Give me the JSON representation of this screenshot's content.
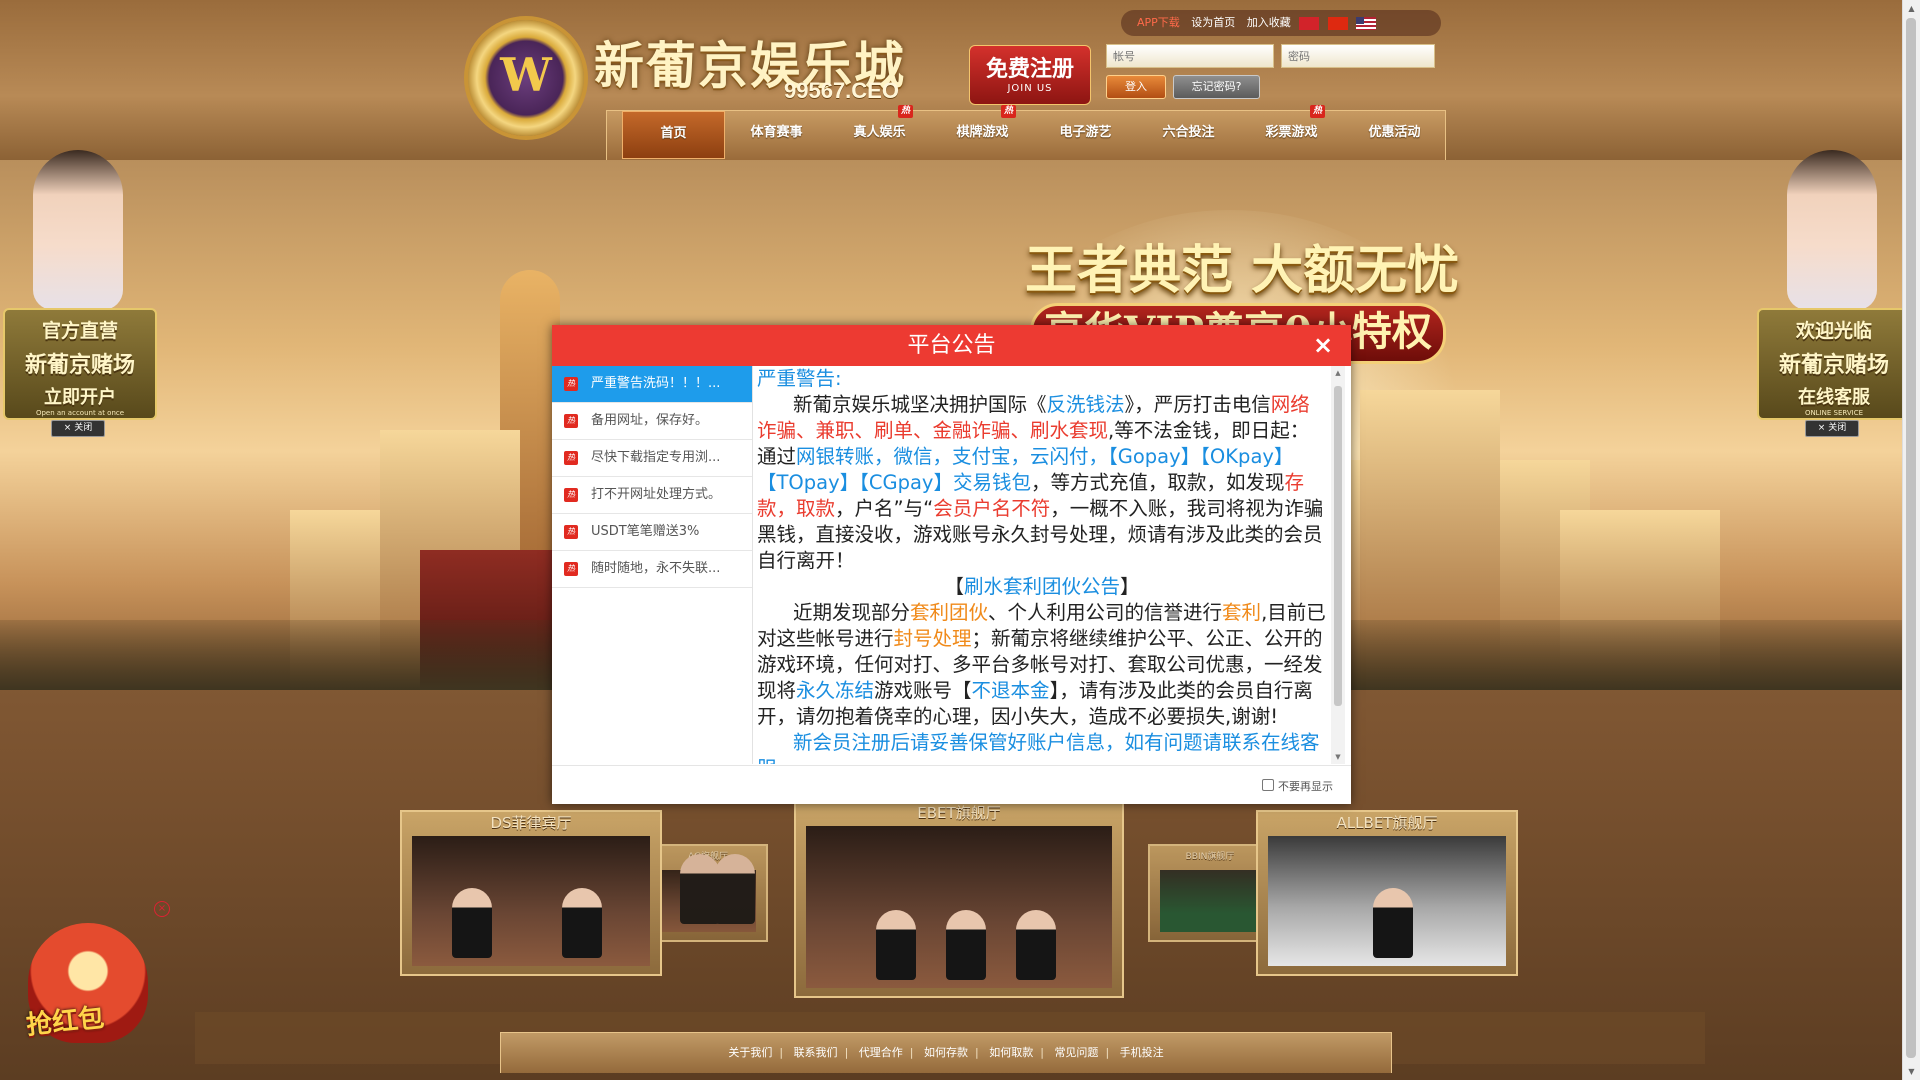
{
  "header": {
    "logo_name": "新葡京娱乐城",
    "logo_domain": "99567.CEO",
    "register_label": "免费注册",
    "register_sub": "JOIN US",
    "topbar": {
      "app_download": "APP下载",
      "set_homepage": "设为首页",
      "add_favorite": "加入收藏"
    },
    "username_placeholder": "帐号",
    "password_placeholder": "密码",
    "login_label": "登入",
    "forgot_label": "忘记密码?"
  },
  "nav": {
    "items": [
      {
        "label": "首页",
        "hot": false
      },
      {
        "label": "体育赛事",
        "hot": false
      },
      {
        "label": "真人娱乐",
        "hot": true
      },
      {
        "label": "棋牌游戏",
        "hot": true
      },
      {
        "label": "电子游艺",
        "hot": false
      },
      {
        "label": "六合投注",
        "hot": false
      },
      {
        "label": "彩票游戏",
        "hot": true
      },
      {
        "label": "优惠活动",
        "hot": false
      }
    ],
    "hot_badge": "热"
  },
  "banner": {
    "slogan_line1": "王者典范 大额无忧",
    "slogan_line2": "享华VIP尊享0小特权"
  },
  "side_left": {
    "line1": "官方直营",
    "line2": "新葡京赌场",
    "line3": "立即开户",
    "line3_sub": "Open an account at once",
    "close_label": "关闭"
  },
  "side_right": {
    "line1": "欢迎光临",
    "line2": "新葡京赌场",
    "line3": "在线客服",
    "line3_sub": "ONLINE SERVICE",
    "close_label": "关闭"
  },
  "halls": {
    "ds": "DS菲律宾厅",
    "ag": "AG旗舰厅",
    "ebet": "EBET旗舰厅",
    "bbin": "BBIN旗舰厅",
    "allbet": "ALLBET旗舰厅"
  },
  "red_packet": {
    "label": "抢红包",
    "close": "×"
  },
  "footer": {
    "links": [
      "关于我们",
      "联系我们",
      "代理合作",
      "如何存款",
      "如何取款",
      "常见问题",
      "手机投注"
    ],
    "separator": "|"
  },
  "modal": {
    "title": "平台公告",
    "close": "×",
    "notices": [
      "严重警告洗码！！！...",
      "备用网址，保存好。",
      "尽快下载指定专用浏...",
      "打不开网址处理方式。",
      "USDT笔笔赠送3%",
      "随时随地，永不失联..."
    ],
    "hot_icon": "热",
    "dont_show": "不要再显示",
    "body": {
      "heading": "严重警告:",
      "p1_a": "新葡京娱乐城坚决拥护国际《",
      "p1_b": "反洗钱法",
      "p1_c": "》，严厉打击电信",
      "p1_d": "网络诈骗、兼职、刷单、金融诈骗、刷水套现",
      "p1_e": ",等不法金钱，即日起：通过",
      "p1_f": "网银转账，微信，支付宝，云闪付，【Gopay】【OKpay】【TOpay】【CGpay】交易钱包",
      "p1_g": "，等方式充值，取款，如发现",
      "p1_h": "存款，取款",
      "p1_i": "，户名”与“",
      "p1_j": "会员户名不符",
      "p1_k": "，一概不入账，我司将视为诈骗黑钱，直接没收，游戏账号永久封号处理，烦请有涉及此类的会员自行离开！",
      "sec2_open": "【",
      "sec2_title": "刷水套利团伙公告",
      "sec2_close": "】",
      "p2_a": "近期发现部分",
      "p2_b": "套利团伙",
      "p2_c": "、个人利用公司的信誉进行",
      "p2_d": "套利",
      "p2_e": ",目前已对这些帐号进行",
      "p2_f": "封号处理",
      "p2_g": "；新葡京将继续维护公平、公正、公开的游戏环境，任何对打、多平台多帐号对打、套取公司优惠，一经发现将",
      "p2_h": "永久冻结",
      "p2_i": "游戏账号【",
      "p2_j": "不退本金",
      "p2_k": "】，请有涉及此类的会员自行离开，请勿抱着侥幸的心理，因小失大，造成不必要损失,谢谢!",
      "p3_partial": "新会员注册后请妥善保管好账户信息，如有问题请联系在线客服"
    }
  }
}
